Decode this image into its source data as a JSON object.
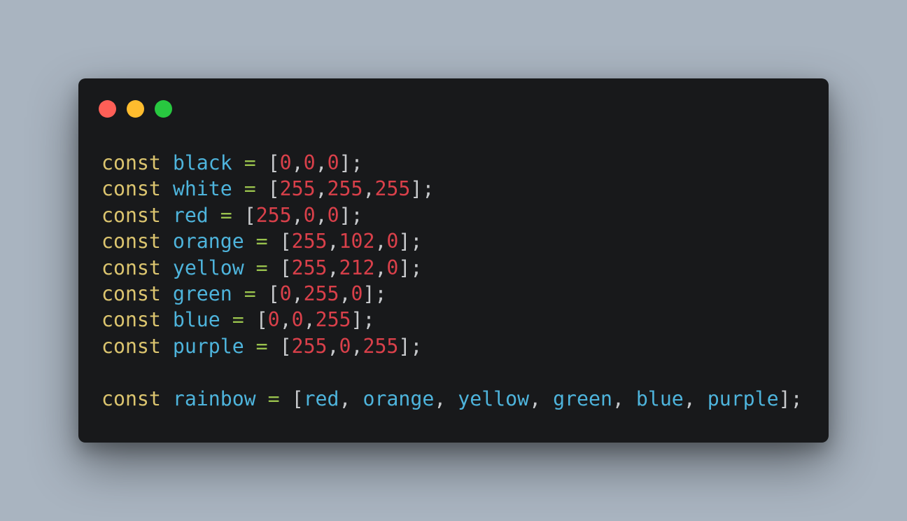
{
  "window": {
    "controls": [
      {
        "name": "close",
        "color": "#ff5f57"
      },
      {
        "name": "minimize",
        "color": "#febc2e"
      },
      {
        "name": "maximize",
        "color": "#28c840"
      }
    ]
  },
  "code": {
    "language": "javascript",
    "lines": [
      "const black = [0,0,0];",
      "const white = [255,255,255];",
      "const red = [255,0,0];",
      "const orange = [255,102,0];",
      "const yellow = [255,212,0];",
      "const green = [0,255,0];",
      "const blue = [0,0,255];",
      "const purple = [255,0,255];",
      "",
      "const rainbow = [red, orange, yellow, green, blue, purple];"
    ]
  },
  "colors": {
    "background": "#a9b4c0",
    "editor_bg": "#18191b",
    "keyword": "#dcc56f",
    "identifier": "#4eb4dc",
    "operator": "#99c24d",
    "punctuation": "#c7c9cc",
    "number": "#d9404a"
  }
}
